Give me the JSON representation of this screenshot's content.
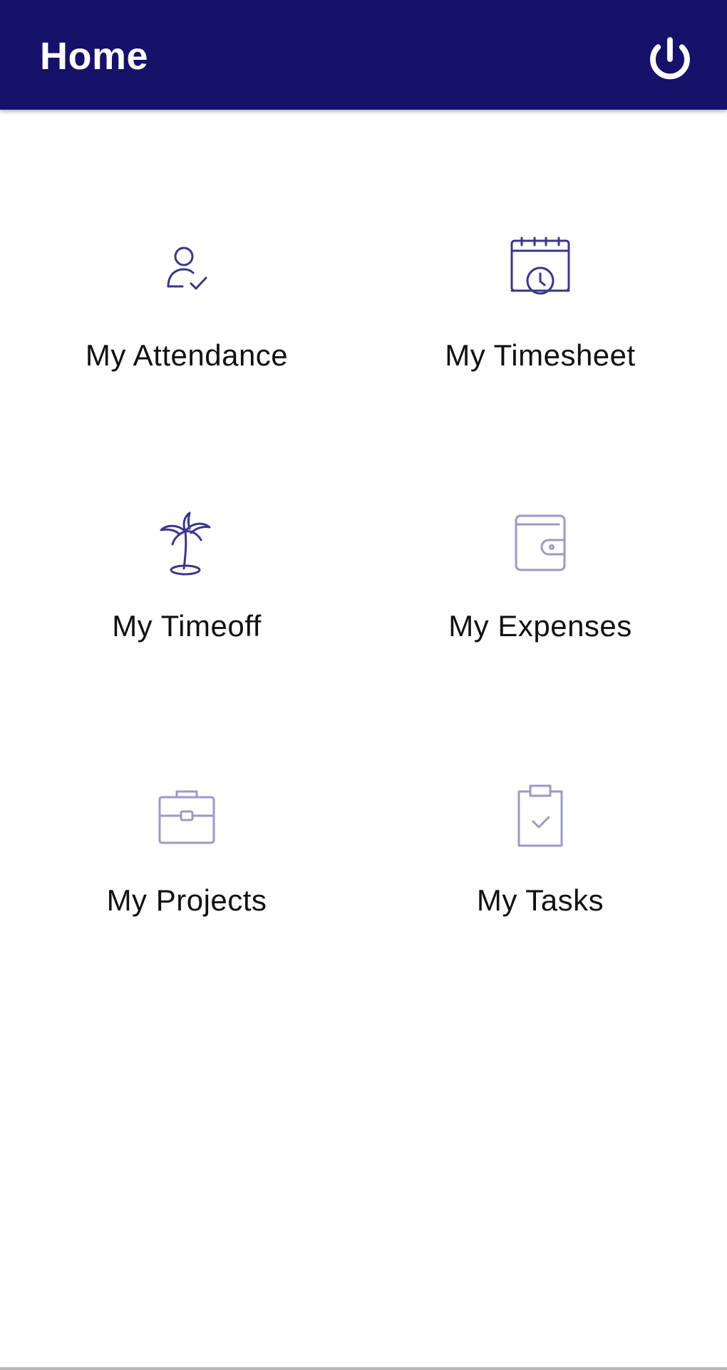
{
  "header": {
    "title": "Home",
    "power_icon": "power-icon"
  },
  "colors": {
    "app_bar": "#16126a",
    "icon_stroke": "#3a3787",
    "icon_stroke_light": "#9c9ac4"
  },
  "tiles": [
    {
      "label": "My Attendance",
      "icon": "user-check-icon"
    },
    {
      "label": "My Timesheet",
      "icon": "calendar-clock-icon"
    },
    {
      "label": "My Timeoff",
      "icon": "palm-tree-icon"
    },
    {
      "label": "My Expenses",
      "icon": "wallet-icon"
    },
    {
      "label": "My Projects",
      "icon": "briefcase-icon"
    },
    {
      "label": "My Tasks",
      "icon": "clipboard-check-icon"
    }
  ]
}
